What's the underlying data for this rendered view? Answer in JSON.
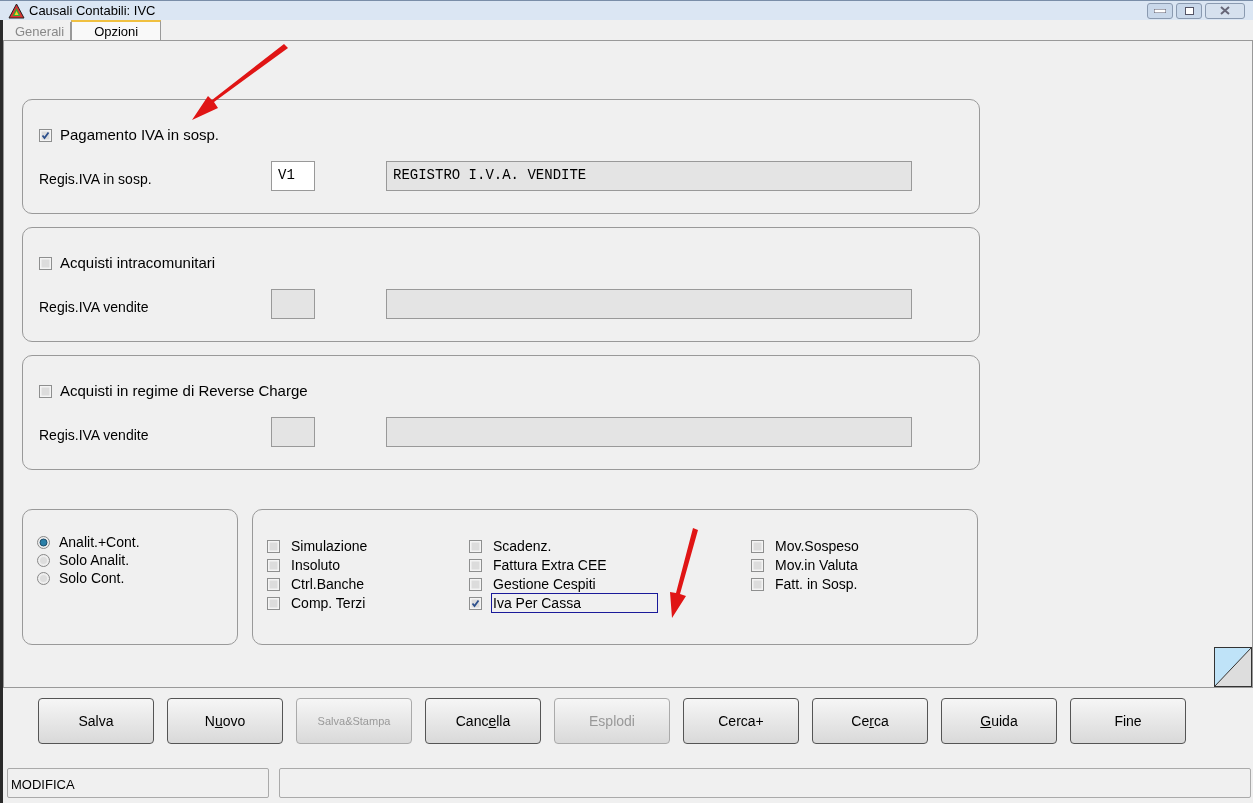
{
  "window": {
    "title": "Causali Contabili: IVC"
  },
  "tabs": [
    {
      "label": "Generali",
      "selected": false
    },
    {
      "label": "Opzioni",
      "selected": true
    }
  ],
  "groups": [
    {
      "checkbox": {
        "label": "Pagamento IVA in sosp.",
        "checked": true
      },
      "field_label": "Regis.IVA in sosp.",
      "code_field": {
        "value": "V1",
        "disabled": false
      },
      "description_field": {
        "value": "REGISTRO I.V.A. VENDITE",
        "disabled": true
      }
    },
    {
      "checkbox": {
        "label": "Acquisti intracomunitari",
        "checked": false
      },
      "field_label": "Regis.IVA vendite",
      "code_field": {
        "disabled": true
      },
      "description_field": {
        "disabled": true
      }
    },
    {
      "checkbox": {
        "label": "Acquisti in regime di Reverse Charge",
        "checked": false
      },
      "field_label": "Regis.IVA vendite",
      "code_field": {
        "disabled": true
      },
      "description_field": {
        "disabled": true
      }
    }
  ],
  "radio_options": [
    {
      "label": "Analit.+Cont.",
      "selected": true
    },
    {
      "label": "Solo Analit.",
      "selected": false
    },
    {
      "label": "Solo Cont.",
      "selected": false
    }
  ],
  "option_columns": [
    [
      {
        "label": "Simulazione",
        "checked": false,
        "focused": false
      },
      {
        "label": "Insoluto",
        "checked": false,
        "focused": false
      },
      {
        "label": "Ctrl.Banche",
        "checked": false,
        "focused": false
      },
      {
        "label": "Comp. Terzi",
        "checked": false,
        "focused": false
      }
    ],
    [
      {
        "label": "Scadenz.",
        "checked": false,
        "focused": false
      },
      {
        "label": "Fattura Extra CEE",
        "checked": false,
        "focused": false
      },
      {
        "label": "Gestione Cespiti",
        "checked": false,
        "focused": false
      },
      {
        "label": "Iva Per Cassa",
        "checked": true,
        "focused": true
      }
    ],
    [
      {
        "label": "Mov.Sospeso",
        "checked": false,
        "focused": false
      },
      {
        "label": "Mov.in Valuta",
        "checked": false,
        "focused": false
      },
      {
        "label": "Fatt. in Sosp.",
        "checked": false,
        "focused": false
      }
    ]
  ],
  "buttons": [
    {
      "label": [
        {
          "text": "Salva",
          "underlined": false
        }
      ],
      "disabled": false
    },
    {
      "label": [
        {
          "text": "N",
          "underlined": false
        },
        {
          "text": "u",
          "underlined": true
        },
        {
          "text": "ovo",
          "underlined": false
        }
      ],
      "disabled": false
    },
    {
      "label": [
        {
          "text": "Salva&Stampa",
          "underlined": false
        }
      ],
      "disabled": true,
      "kind": "small"
    },
    {
      "label": [
        {
          "text": "Canc",
          "underlined": false
        },
        {
          "text": "e",
          "underlined": true
        },
        {
          "text": "lla",
          "underlined": false
        }
      ],
      "disabled": false
    },
    {
      "label": [
        {
          "text": "Esplodi",
          "underlined": false
        }
      ],
      "disabled": true
    },
    {
      "label": [
        {
          "text": "Cerca+",
          "underlined": false
        }
      ],
      "disabled": false
    },
    {
      "label": [
        {
          "text": "Ce",
          "underlined": false
        },
        {
          "text": "r",
          "underlined": true
        },
        {
          "text": "ca",
          "underlined": false
        }
      ],
      "disabled": false
    },
    {
      "label": [
        {
          "text": "G",
          "underlined": true
        },
        {
          "text": "uida",
          "underlined": false
        }
      ],
      "disabled": false
    },
    {
      "label": [
        {
          "text": "Fine",
          "underlined": false
        }
      ],
      "disabled": false
    }
  ],
  "status_bar": {
    "mode": "MODIFICA"
  }
}
